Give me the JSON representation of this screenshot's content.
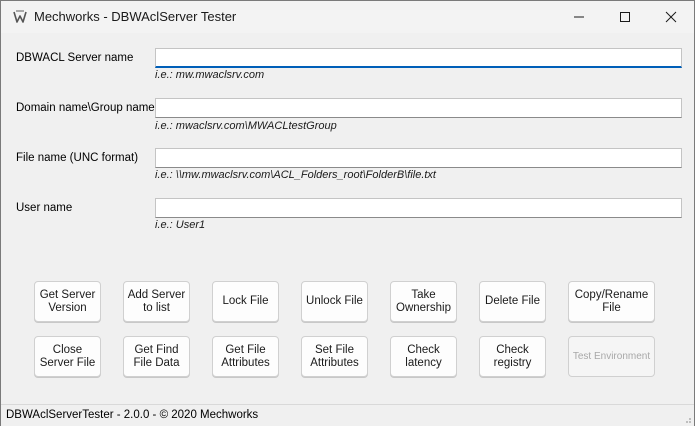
{
  "window": {
    "title": "Mechworks - DBWAclServer Tester"
  },
  "fields": [
    {
      "label": "DBWACL Server name",
      "value": "",
      "hint": "i.e.: mw.mwaclsrv.com"
    },
    {
      "label": "Domain name\\Group name",
      "value": "",
      "hint": "i.e.: mwaclsrv.com\\MWACLtestGroup"
    },
    {
      "label": "File name (UNC format)",
      "value": "",
      "hint": "i.e.: \\\\mw.mwaclsrv.com\\ACL_Folders_root\\FolderB\\file.txt"
    },
    {
      "label": "User name",
      "value": "",
      "hint": "i.e.: User1"
    }
  ],
  "buttons": {
    "get_server_version": "Get Server\nVersion",
    "add_server": "Add Server\nto list",
    "lock_file": "Lock File",
    "unlock_file": "Unlock File",
    "take_ownership": "Take\nOwnership",
    "delete_file": "Delete File",
    "copy_rename": "Copy/Rename\nFile",
    "close_server_file": "Close\nServer File",
    "get_find_file_data": "Get Find\nFile Data",
    "get_file_attributes": "Get File\nAttributes",
    "set_file_attributes": "Set File\nAttributes",
    "check_latency": "Check\nlatency",
    "check_registry": "Check\nregistry",
    "test_environment": "Test Environment"
  },
  "status": {
    "text": "DBWAclServerTester - 2.0.0 - © 2020 Mechworks"
  },
  "colors": {
    "accent": "#005fb8",
    "background": "#f0f0f0",
    "disabled_text": "#a8a8a8"
  }
}
